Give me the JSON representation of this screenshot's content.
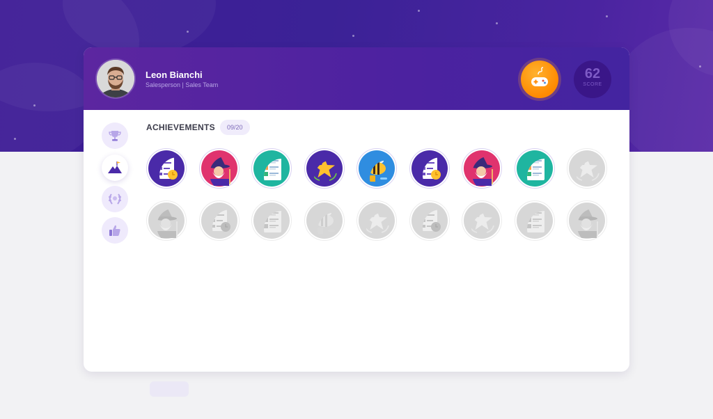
{
  "user": {
    "name": "Leon Bianchi",
    "role": "Salesperson | Sales Team"
  },
  "score": {
    "value": "62",
    "label": "SCORE"
  },
  "nav": {
    "items": [
      {
        "icon": "trophy-icon",
        "active": false
      },
      {
        "icon": "mountain-flag-icon",
        "active": true
      },
      {
        "icon": "laurel-icon",
        "active": false
      },
      {
        "icon": "thumbs-up-icon",
        "active": false
      }
    ]
  },
  "achievements": {
    "title": "ACHIEVEMENTS",
    "count": "09/20",
    "earned_row": [
      "checklist",
      "wizard",
      "contacts",
      "star",
      "bee",
      "checklist",
      "wizard",
      "contacts",
      "locked-star"
    ],
    "locked_row": [
      "wizard",
      "checklist",
      "contacts",
      "bee",
      "star",
      "checklist",
      "star",
      "contacts",
      "wizard"
    ]
  },
  "colors": {
    "accent": "#4d22a0",
    "game_button": "#ff8a00",
    "score_bg": "#3a1688"
  }
}
